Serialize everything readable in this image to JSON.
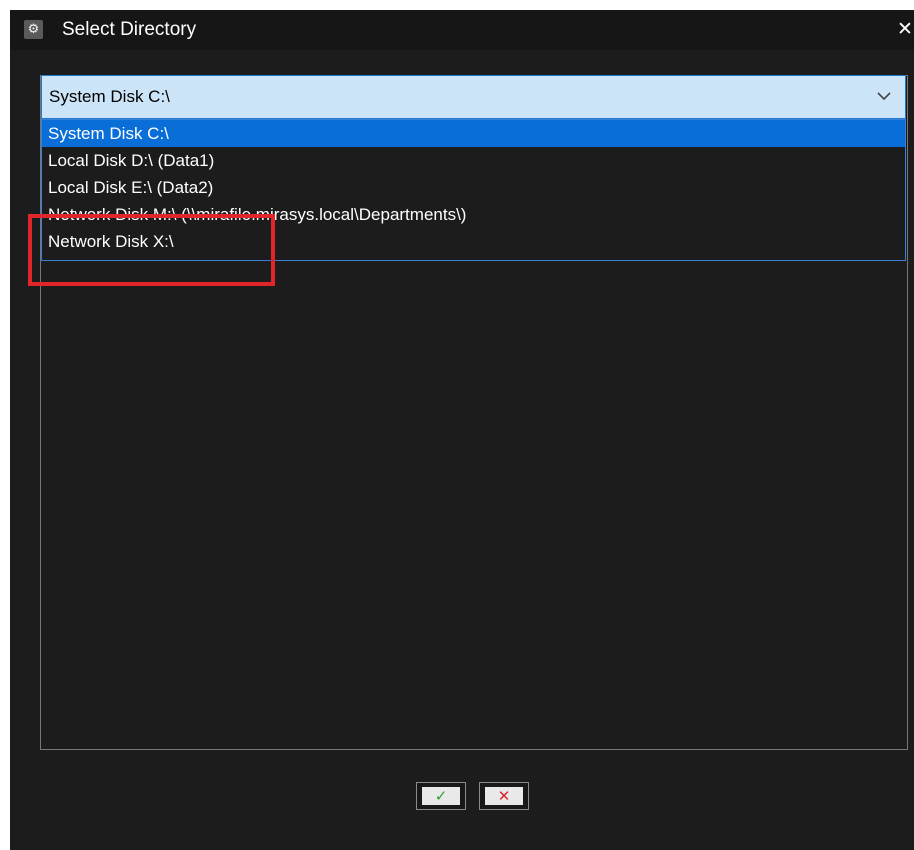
{
  "window": {
    "title": "Select Directory",
    "app_icon": "gear-icon",
    "close_icon": "close-icon"
  },
  "combo": {
    "value": "System Disk C:\\",
    "chevron_icon": "chevron-down-icon"
  },
  "dropdown": {
    "options": [
      {
        "label": "System Disk C:\\",
        "selected": true
      },
      {
        "label": "Local Disk D:\\ (Data1)",
        "selected": false
      },
      {
        "label": "Local Disk E:\\ (Data2)",
        "selected": false
      },
      {
        "label": "Network Disk M:\\ (\\\\mirafile.mirasys.local\\Departments\\)",
        "selected": false
      },
      {
        "label": "Network Disk X:\\",
        "selected": false
      }
    ]
  },
  "buttons": {
    "ok_icon": "checkmark-icon",
    "cancel_icon": "cross-icon"
  },
  "colors": {
    "background": "#1c1c1c",
    "combo_fill": "#cce4f7",
    "selection": "#0a6ed8",
    "highlight_box": "#e0262a",
    "ok": "#2fa22f",
    "cancel": "#d8262b"
  }
}
